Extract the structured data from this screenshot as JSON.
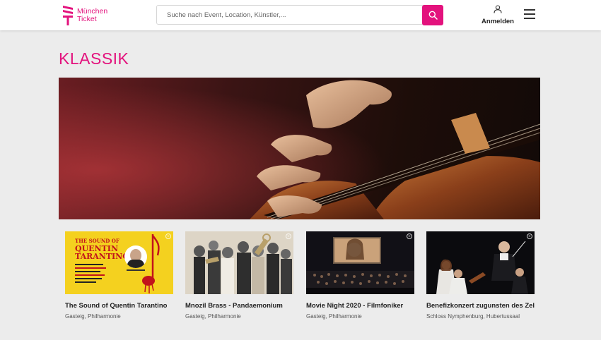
{
  "brand": {
    "line1": "München",
    "line2": "Ticket",
    "color": "#e3127d"
  },
  "search": {
    "placeholder": "Suche nach Event, Location, Künstler,..."
  },
  "header": {
    "login_label": "Anmelden"
  },
  "page": {
    "title": "KLASSIK"
  },
  "events": [
    {
      "title": "The Sound of Quentin Tarantino",
      "venue": "Gasteig, Philharmonie",
      "poster_title": [
        "THE SOUND OF",
        "QUENTIN",
        "TARANTINO"
      ]
    },
    {
      "title": "Mnozil Brass - Pandaemonium",
      "venue": "Gasteig, Philharmonie"
    },
    {
      "title": "Movie Night 2020 - Filmfoniker",
      "venue": "Gasteig, Philharmonie"
    },
    {
      "title": "Benefizkonzert zugunsten des Zelt…",
      "venue": "Schloss Nymphenburg, Hubertussaal"
    }
  ],
  "icons": [
    "search-icon",
    "user-icon",
    "menu-icon",
    "copyright-icon"
  ]
}
